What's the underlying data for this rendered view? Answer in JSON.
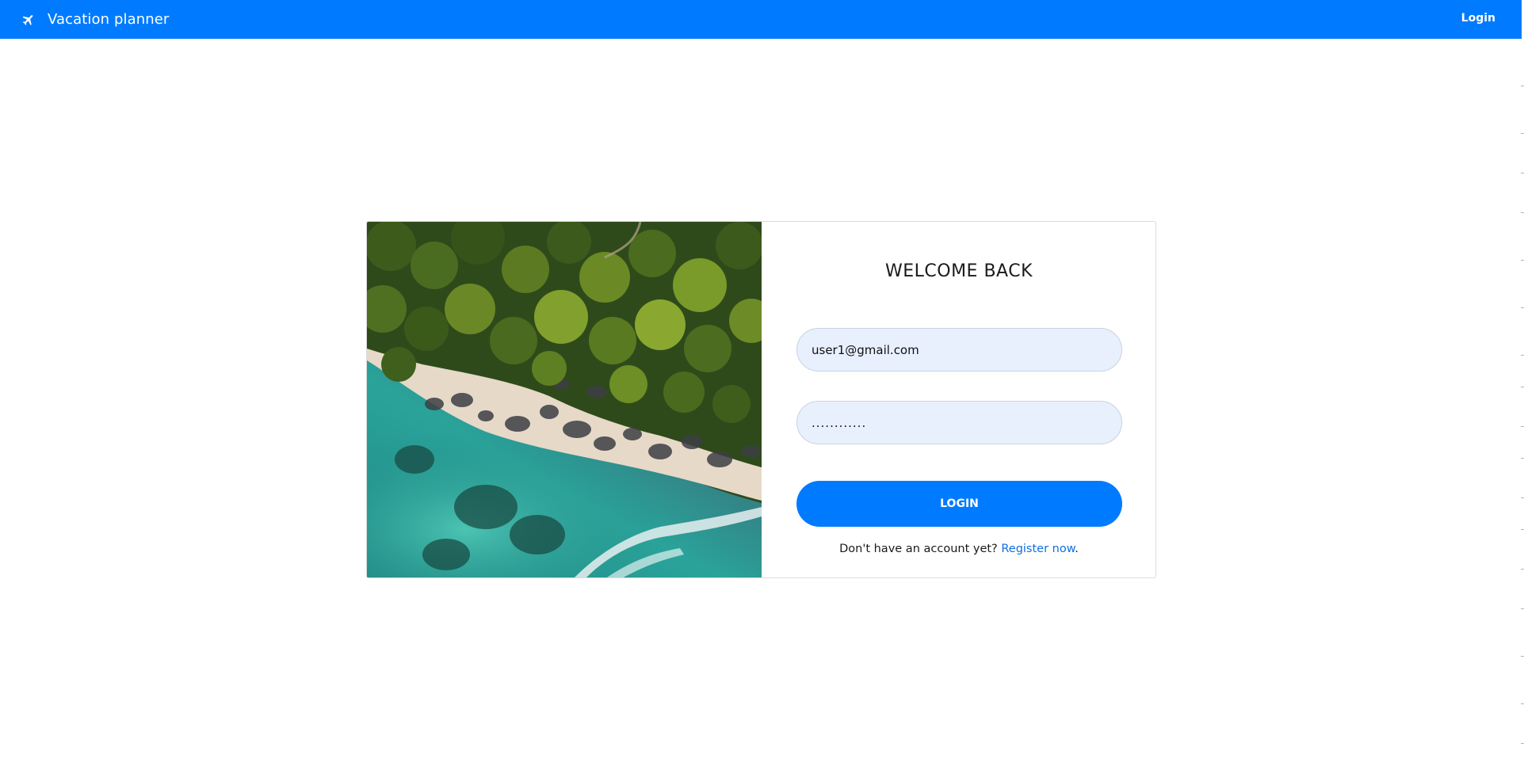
{
  "navbar": {
    "brand": "Vacation planner",
    "brand_icon": "airplane-icon",
    "login_link": "Login",
    "color": "#007bff"
  },
  "login_card": {
    "image": "aerial beach photo",
    "heading": "WELCOME BACK",
    "email_value": "user1@gmail.com",
    "password_value": "............",
    "login_button": "LOGIN",
    "register_prompt": "Don't have an account yet?",
    "register_link": "Register now",
    "register_suffix": "."
  },
  "colors": {
    "accent": "#007bff",
    "input_bg": "#e8f0fe",
    "link": "#0b6fe0"
  }
}
